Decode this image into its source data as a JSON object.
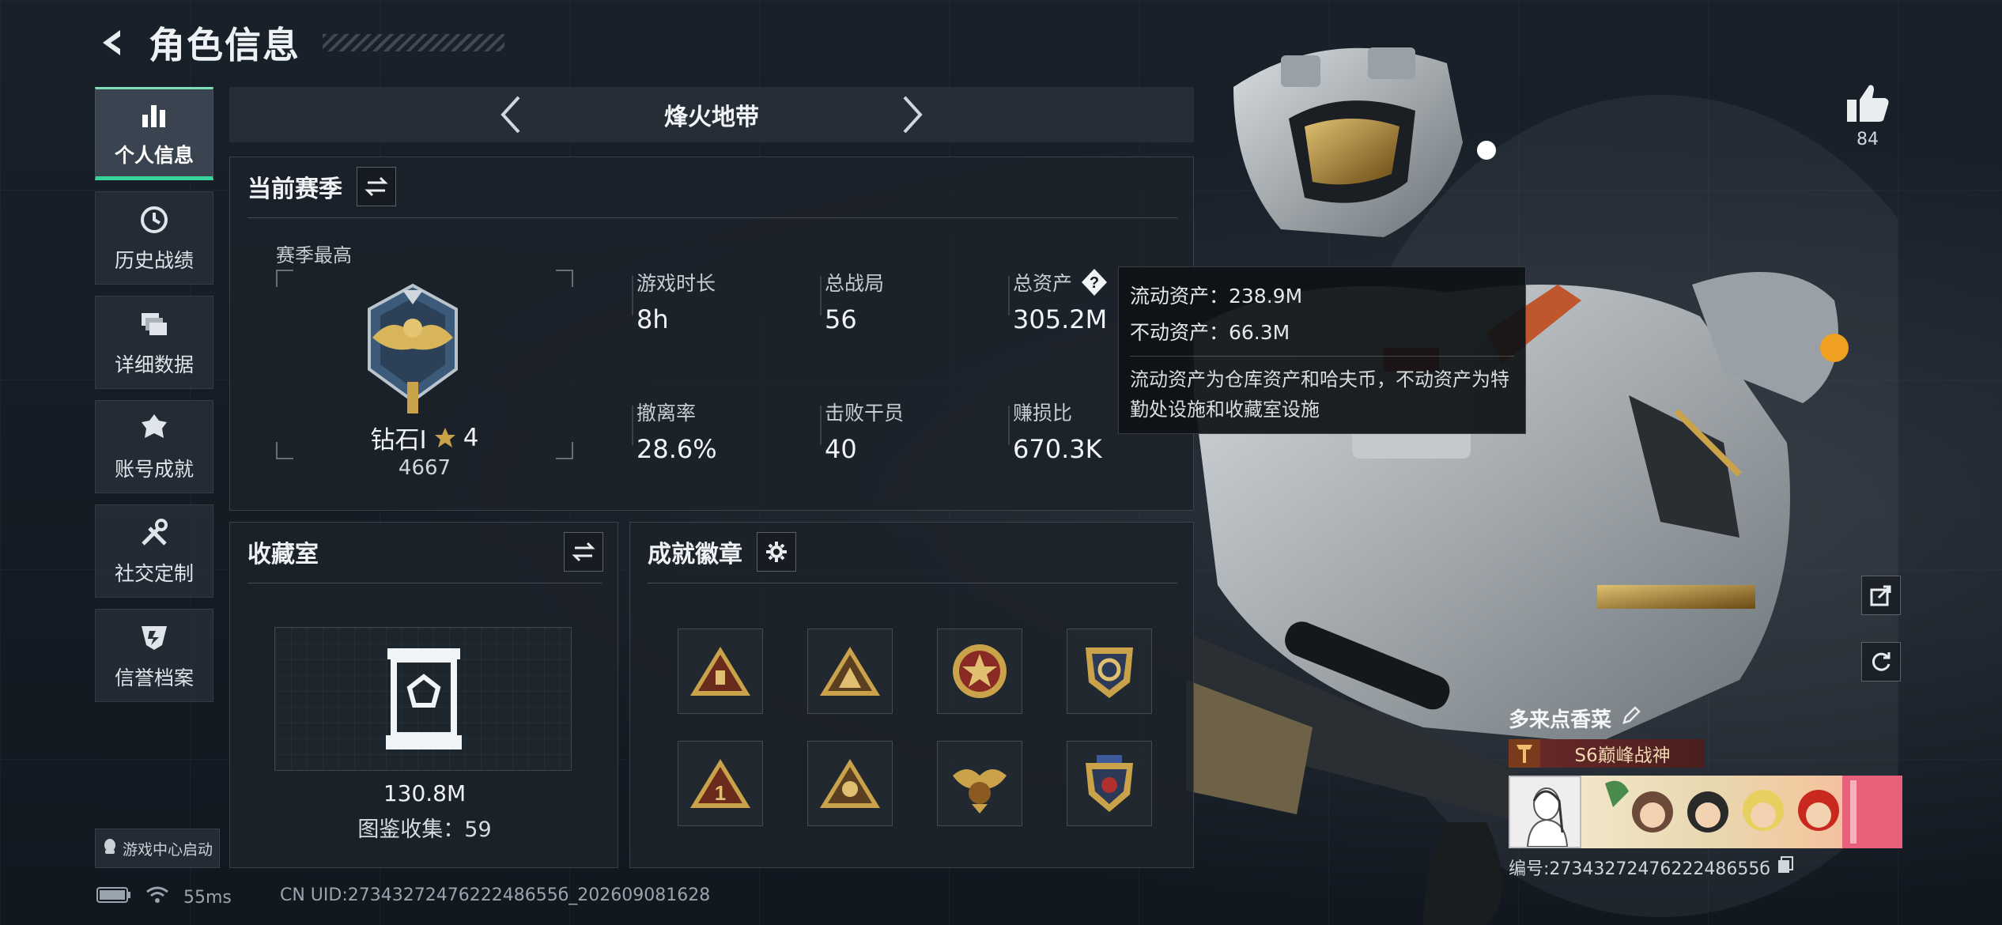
{
  "header": {
    "title": "角色信息"
  },
  "sidebar": {
    "items": [
      {
        "label": "个人信息",
        "icon": "bar-chart-icon",
        "active": true
      },
      {
        "label": "历史战绩",
        "icon": "clock-icon",
        "active": false
      },
      {
        "label": "详细数据",
        "icon": "stack-icon",
        "active": false
      },
      {
        "label": "账号成就",
        "icon": "achievement-icon",
        "active": false
      },
      {
        "label": "社交定制",
        "icon": "tools-icon",
        "active": false
      },
      {
        "label": "信誉档案",
        "icon": "shield-icon",
        "active": false
      }
    ],
    "game_center": "游戏中心启动"
  },
  "mode": {
    "name": "烽火地带"
  },
  "season": {
    "title": "当前赛季",
    "best_label": "赛季最高",
    "rank_name": "钻石I",
    "rank_stars": "4",
    "rank_score": "4667",
    "stats": [
      {
        "label": "游戏时长",
        "value": "8h"
      },
      {
        "label": "总战局",
        "value": "56"
      },
      {
        "label": "总资产",
        "value": "305.2M"
      },
      {
        "label": "撤离率",
        "value": "28.6%"
      },
      {
        "label": "击败干员",
        "value": "40"
      },
      {
        "label": "赚损比",
        "value": "670.3K"
      }
    ]
  },
  "tooltip": {
    "liquid": "流动资产：238.9M",
    "fixed": "不动资产：66.3M",
    "desc": "流动资产为仓库资产和哈夫币，不动资产为特勤处设施和收藏室设施"
  },
  "collection": {
    "title": "收藏室",
    "value": "130.8M",
    "count": "图鉴收集：59"
  },
  "achievements": {
    "title": "成就徽章"
  },
  "status": {
    "ping": "55ms",
    "uid": "CN UID:2734327247622248655б_202609081628"
  },
  "like": {
    "count": "84"
  },
  "player": {
    "name": "多来点香菜",
    "title_tag": "S6巅峰战神",
    "id": "编号:2734327247622248655б"
  },
  "colors": {
    "accent": "#37d39b",
    "gold": "#c9a24a"
  }
}
